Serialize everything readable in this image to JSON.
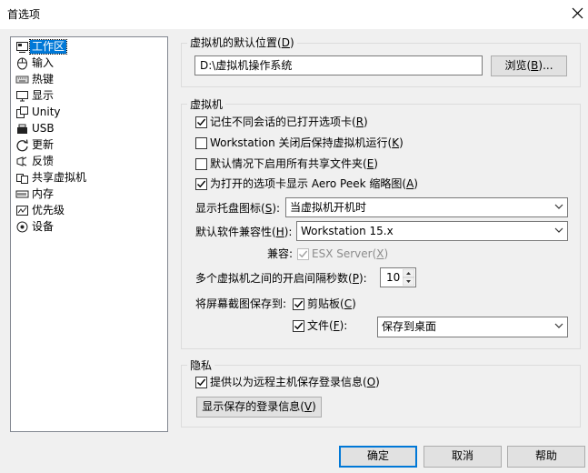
{
  "window": {
    "title": "首选项"
  },
  "nav": {
    "items": [
      {
        "label": "工作区",
        "icon": "workspace-icon"
      },
      {
        "label": "输入",
        "icon": "mouse-icon"
      },
      {
        "label": "热键",
        "icon": "keyboard-icon"
      },
      {
        "label": "显示",
        "icon": "monitor-icon"
      },
      {
        "label": "Unity",
        "icon": "unity-icon"
      },
      {
        "label": "USB",
        "icon": "usb-icon"
      },
      {
        "label": "更新",
        "icon": "update-icon"
      },
      {
        "label": "反馈",
        "icon": "feedback-icon"
      },
      {
        "label": "共享虚拟机",
        "icon": "shared-vm-icon"
      },
      {
        "label": "内存",
        "icon": "memory-icon"
      },
      {
        "label": "优先级",
        "icon": "priority-icon"
      },
      {
        "label": "设备",
        "icon": "device-icon"
      }
    ],
    "selected": "工作区"
  },
  "default_location": {
    "group_title": "虚拟机的默认位置",
    "group_key": "D",
    "path_value": "D:\\虚拟机操作系统",
    "browse_label": "浏览",
    "browse_key": "B"
  },
  "vm": {
    "group_title": "虚拟机",
    "remember_tabs": {
      "label": "记住不同会话的已打开选项卡",
      "key": "R",
      "checked": true
    },
    "keep_running": {
      "label": "Workstation 关闭后保持虚拟机运行",
      "key": "K",
      "checked": false
    },
    "enable_shared_folders": {
      "label": "默认情况下启用所有共享文件夹",
      "key": "E",
      "checked": false
    },
    "aero_peek": {
      "label": "为打开的选项卡显示 Aero Peek 缩略图",
      "key": "A",
      "checked": true
    },
    "tray_icon": {
      "label": "显示托盘图标",
      "key": "S",
      "value": "当虚拟机开机时"
    },
    "compat": {
      "label": "默认软件兼容性",
      "key": "H",
      "value": "Workstation 15.x"
    },
    "compatible": {
      "label": "兼容:",
      "option": "ESX Server",
      "key": "X",
      "checked": true,
      "disabled": true
    },
    "startup_interval": {
      "label": "多个虚拟机之间的开启间隔秒数",
      "key": "P",
      "value": "10"
    },
    "screenshot_to": {
      "label": "将屏幕截图保存到:"
    },
    "clipboard": {
      "label": "剪贴板",
      "key": "C",
      "checked": true
    },
    "file": {
      "label": "文件",
      "key": "F",
      "checked": true,
      "value": "保存到桌面"
    }
  },
  "privacy": {
    "group_title": "隐私",
    "save_login": {
      "label": "提供以为远程主机保存登录信息",
      "key": "O",
      "checked": true
    },
    "show_login_label": "显示保存的登录信息",
    "show_login_key": "V"
  },
  "footer": {
    "ok_label": "确定",
    "cancel_label": "取消",
    "help_label": "帮助"
  }
}
